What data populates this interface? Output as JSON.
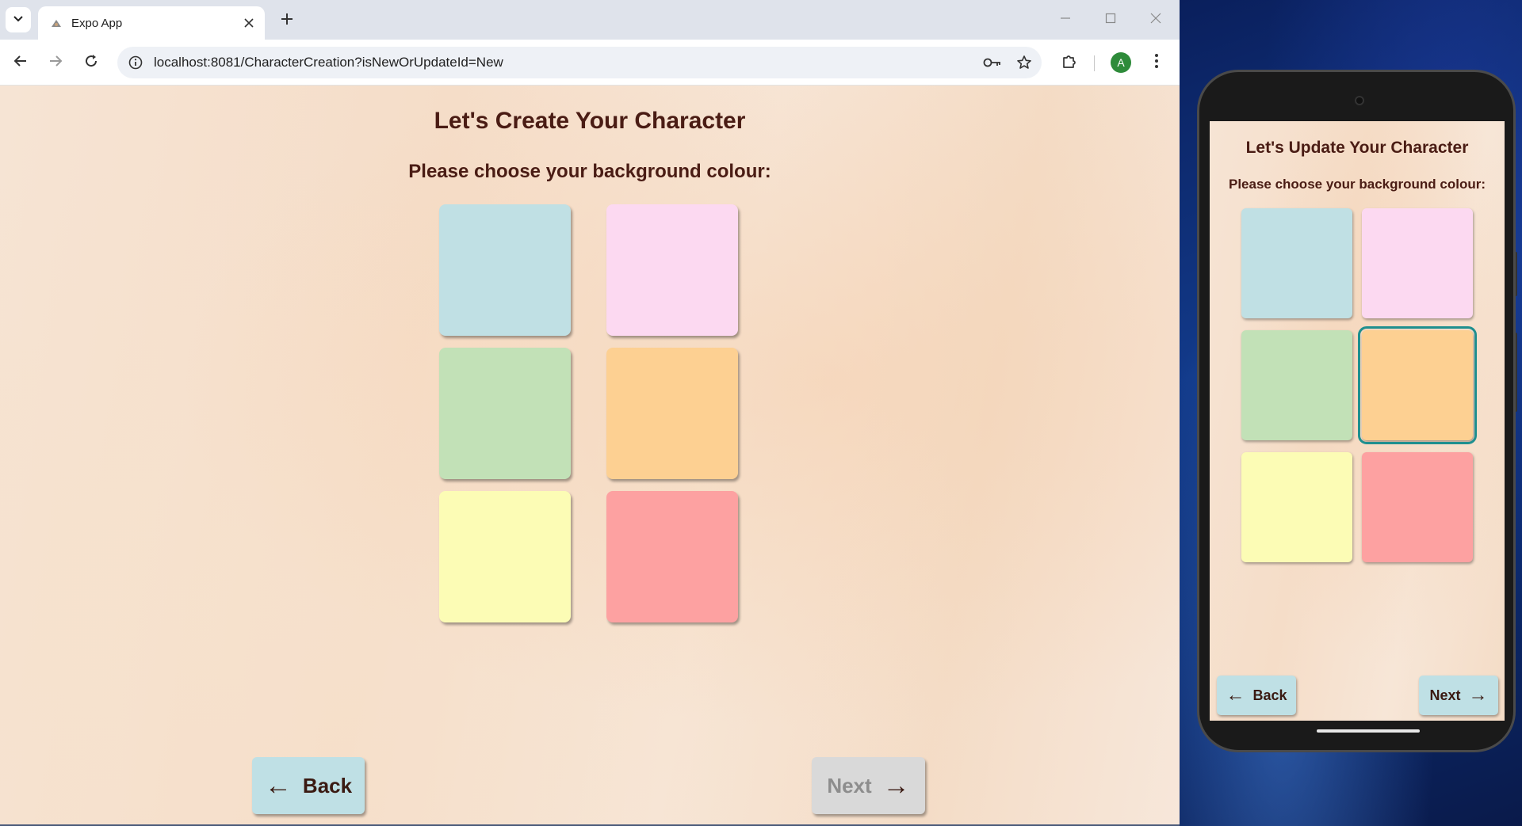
{
  "browser": {
    "tab": {
      "title": "Expo App"
    },
    "url": "localhost:8081/CharacterCreation?isNewOrUpdateId=New",
    "profile_initial": "A",
    "icons": {
      "tab_dropdown": "chevron-down-icon",
      "favicon": "expo-icon",
      "tab_close": "close-icon",
      "new_tab": "plus-icon",
      "minimize": "minimize-icon",
      "maximize": "maximize-icon",
      "window_close": "close-icon",
      "back": "arrow-left-icon",
      "forward": "arrow-right-icon",
      "reload": "reload-icon",
      "site_info": "info-icon",
      "passwords": "key-icon",
      "bookmark": "star-icon",
      "extensions": "puzzle-icon",
      "menu": "kebab-menu-icon"
    }
  },
  "web_page": {
    "title": "Let's Create Your Character",
    "subtitle": "Please choose your background colour:",
    "swatches": [
      {
        "name": "light-blue",
        "color": "#c0e0e4"
      },
      {
        "name": "light-pink",
        "color": "#fcd9f1"
      },
      {
        "name": "light-green",
        "color": "#c2e1b7"
      },
      {
        "name": "light-orange",
        "color": "#fdd092"
      },
      {
        "name": "light-yellow",
        "color": "#fcfcb5"
      },
      {
        "name": "light-red",
        "color": "#fda1a1"
      }
    ],
    "selected_index": null,
    "back_button": {
      "label": "Back",
      "arrow": "←",
      "color": "#bfe0e5"
    },
    "next_button": {
      "label": "Next",
      "arrow": "→",
      "disabled": true,
      "color": "#d9d9d9"
    }
  },
  "emulator": {
    "title": "Let's Update Your Character",
    "subtitle": "Please choose your background colour:",
    "selected_index": 3,
    "selected_outline_color": "#1f8f8f",
    "back_button": {
      "label": "Back",
      "arrow": "←"
    },
    "next_button": {
      "label": "Next",
      "arrow": "→"
    }
  }
}
